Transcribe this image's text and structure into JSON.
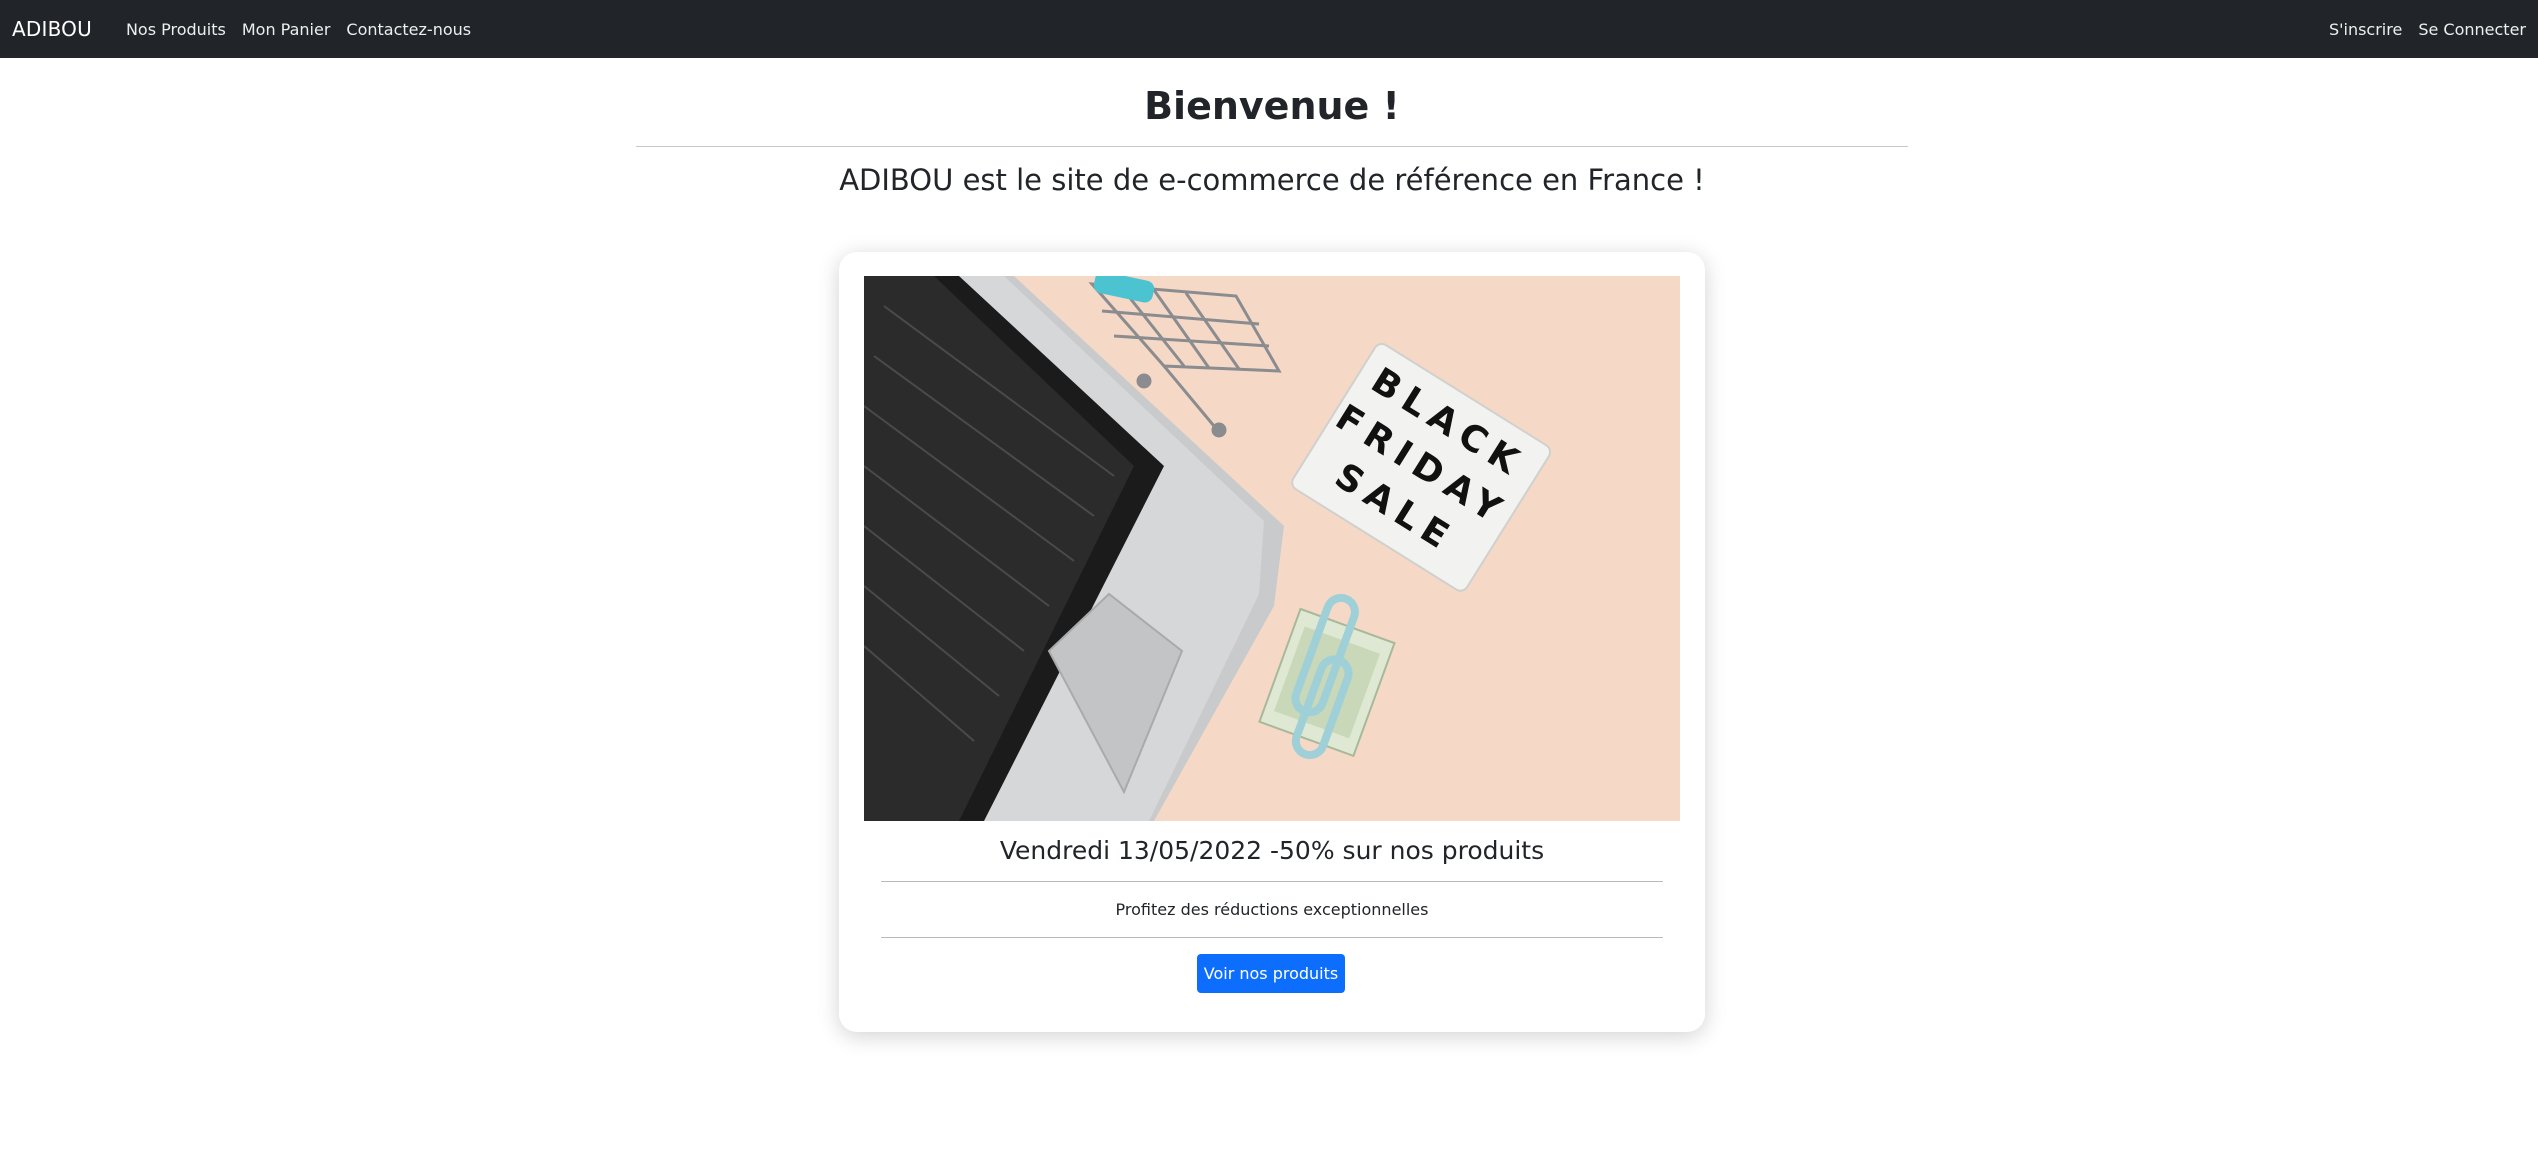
{
  "navbar": {
    "brand": "ADIBOU",
    "links": [
      "Nos Produits",
      "Mon Panier",
      "Contactez-nous"
    ],
    "right_links": [
      "S'inscrire",
      "Se Connecter"
    ]
  },
  "hero": {
    "title": "Bienvenue !",
    "subtitle": "ADIBOU est le site de e-commerce de référence en France !"
  },
  "promo_card": {
    "image_sign_text": [
      "BLACK",
      "FRIDAY",
      "SALE"
    ],
    "title": "Vendredi 13/05/2022 -50% sur nos produits",
    "text": "Profitez des réductions exceptionnelles",
    "button_label": "Voir nos produits"
  },
  "colors": {
    "navbar_bg": "#212529",
    "primary_button": "#0d6efd",
    "image_background": "#f5d9c6"
  }
}
